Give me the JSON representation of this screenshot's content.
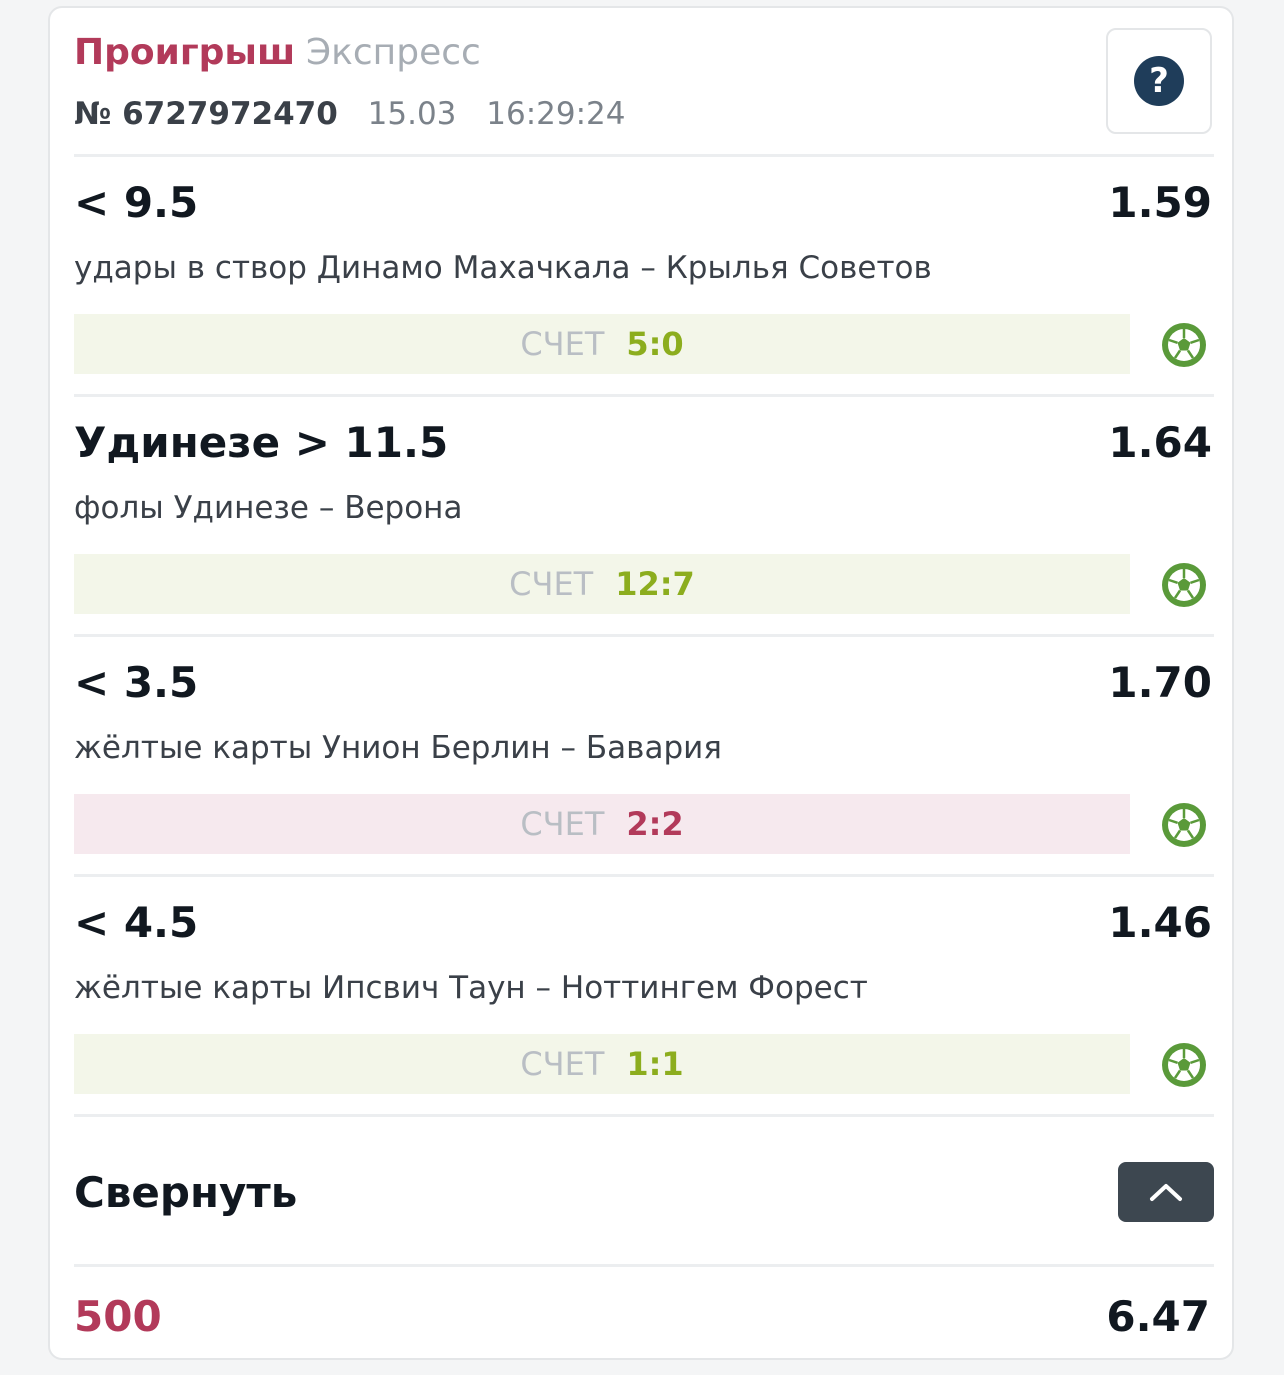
{
  "bet": {
    "status": "Проигрыш",
    "type": "Экспресс",
    "number": "№ 6727972470",
    "date": "15.03",
    "time": "16:29:24",
    "help_icon": "?"
  },
  "events": [
    {
      "pick": "< 9.5",
      "odds": "1.59",
      "description": "удары в створ Динамо Махачкала – Крылья Советов",
      "score_label": "СЧЕТ",
      "score": "5:0",
      "result": "win",
      "sport_icon": "soccer-ball-icon"
    },
    {
      "pick": "Удинезе > 11.5",
      "odds": "1.64",
      "description": "фолы Удинезе – Верона",
      "score_label": "СЧЕТ",
      "score": "12:7",
      "result": "win",
      "sport_icon": "soccer-ball-icon"
    },
    {
      "pick": "< 3.5",
      "odds": "1.70",
      "description": "жёлтые карты Унион Берлин – Бавария",
      "score_label": "СЧЕТ",
      "score": "2:2",
      "result": "lose",
      "sport_icon": "soccer-ball-icon"
    },
    {
      "pick": "< 4.5",
      "odds": "1.46",
      "description": "жёлтые карты Ипсвич Таун – Ноттингем Форест",
      "score_label": "СЧЕТ",
      "score": "1:1",
      "result": "win",
      "sport_icon": "soccer-ball-icon"
    }
  ],
  "collapse": {
    "label": "Свернуть",
    "icon": "chevron-up-icon"
  },
  "footer": {
    "stake": "500",
    "total_odds": "6.47"
  },
  "colors": {
    "loss_accent": "#b23a5a",
    "win_accent": "#8cad1e",
    "win_bg": "#f3f6e9",
    "lose_bg": "#f6e9ee",
    "ball_green": "#5a9a3a",
    "dark_button": "#3d4750",
    "help_circle": "#1f3d5a"
  }
}
